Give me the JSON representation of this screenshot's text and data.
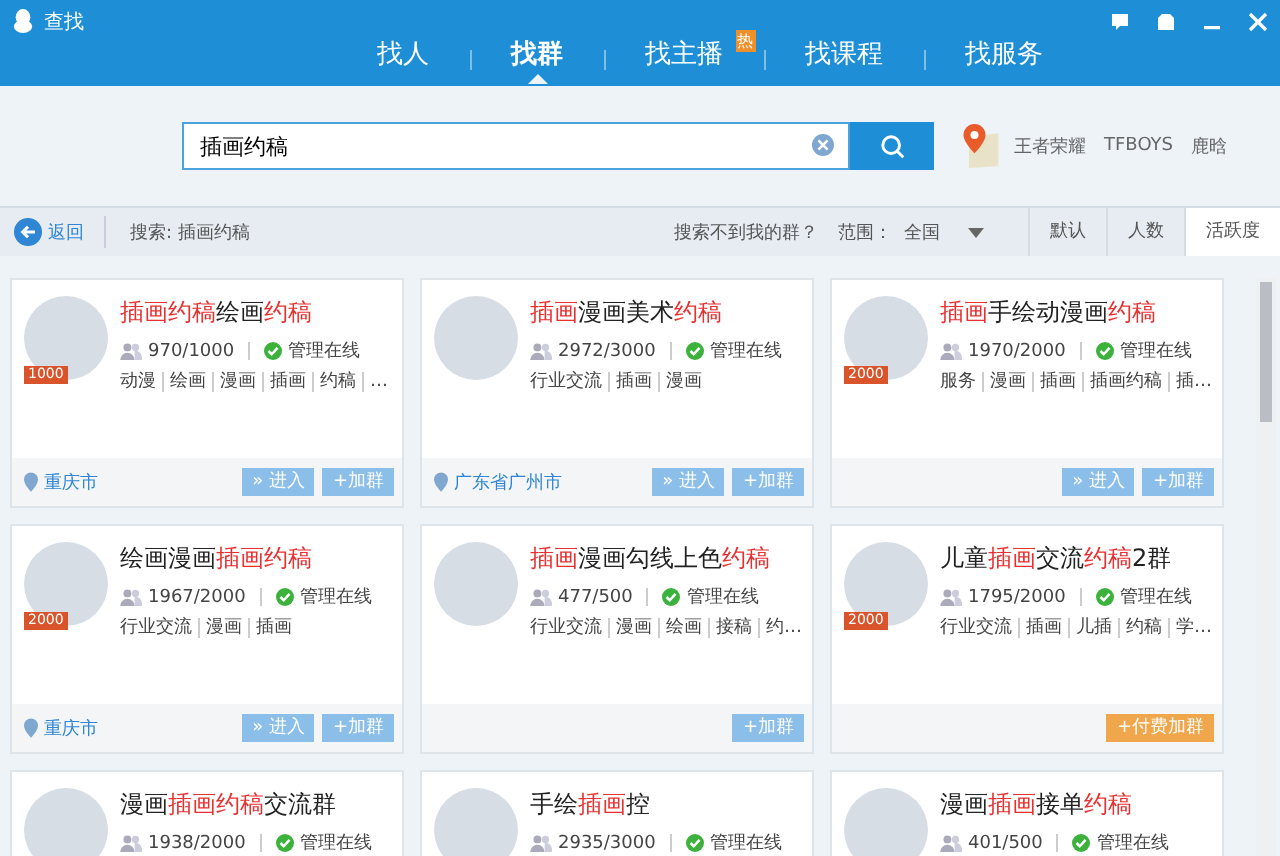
{
  "window": {
    "title": "查找"
  },
  "nav_tabs": [
    {
      "label": "找人",
      "selected": false
    },
    {
      "label": "找群",
      "selected": true
    },
    {
      "label": "找主播",
      "selected": false,
      "badge": "热"
    },
    {
      "label": "找课程",
      "selected": false
    },
    {
      "label": "找服务",
      "selected": false
    }
  ],
  "search": {
    "value": "插画约稿"
  },
  "hot_words": [
    "王者荣耀",
    "TFBOYS",
    "鹿晗"
  ],
  "toolbar": {
    "back": "返回",
    "query": "搜索: 插画约稿",
    "help_link": "搜索不到我的群？",
    "range_label": "范围：",
    "range_value": "全国",
    "sort_tabs": [
      {
        "label": "默认",
        "selected": false
      },
      {
        "label": "人数",
        "selected": false
      },
      {
        "label": "活跃度",
        "selected": true
      }
    ]
  },
  "groups": [
    {
      "title": "**插画约稿**绘画**约稿**",
      "badge": "1000",
      "members": "970/1000",
      "status": "管理在线",
      "tags": [
        "动漫",
        "绘画",
        "漫画",
        "插画",
        "约稿",
        "…"
      ],
      "location": "重庆市",
      "enter": "» 进入",
      "join": {
        "kind": "join",
        "label": "+加群"
      }
    },
    {
      "title": "**插画**漫画美术**约稿**",
      "members": "2972/3000",
      "status": "管理在线",
      "tags": [
        "行业交流",
        "插画",
        "漫画"
      ],
      "location": "广东省广州市",
      "enter": "» 进入",
      "join": {
        "kind": "join",
        "label": "+加群"
      }
    },
    {
      "title": "**插画**手绘动漫画**约稿**",
      "badge": "2000",
      "members": "1970/2000",
      "status": "管理在线",
      "tags": [
        "服务",
        "漫画",
        "插画",
        "插画约稿",
        "插…"
      ],
      "enter": "» 进入",
      "join": {
        "kind": "join",
        "label": "+加群"
      }
    },
    {
      "title": "绘画漫画**插画约稿**",
      "badge": "2000",
      "members": "1967/2000",
      "status": "管理在线",
      "tags": [
        "行业交流",
        "漫画",
        "插画"
      ],
      "location": "重庆市",
      "enter": "» 进入",
      "join": {
        "kind": "join",
        "label": "+加群"
      }
    },
    {
      "title": "**插画**漫画勾线上色**约稿**",
      "members": "477/500",
      "status": "管理在线",
      "tags": [
        "行业交流",
        "漫画",
        "绘画",
        "接稿",
        "约…"
      ],
      "join": {
        "kind": "join",
        "label": "+加群"
      }
    },
    {
      "title": "儿童**插画**交流**约稿**2群",
      "badge": "2000",
      "members": "1795/2000",
      "status": "管理在线",
      "tags": [
        "行业交流",
        "插画",
        "儿插",
        "约稿",
        "学…"
      ],
      "join": {
        "kind": "paid",
        "label": "+付费加群"
      }
    },
    {
      "title": "漫画**插画约稿**交流群",
      "members": "1938/2000",
      "status": "管理在线"
    },
    {
      "title": "手绘**插画**控",
      "members": "2935/3000",
      "status": "管理在线"
    },
    {
      "title": "漫画**插画**接单**约稿**",
      "members": "401/500",
      "status": "管理在线"
    }
  ]
}
